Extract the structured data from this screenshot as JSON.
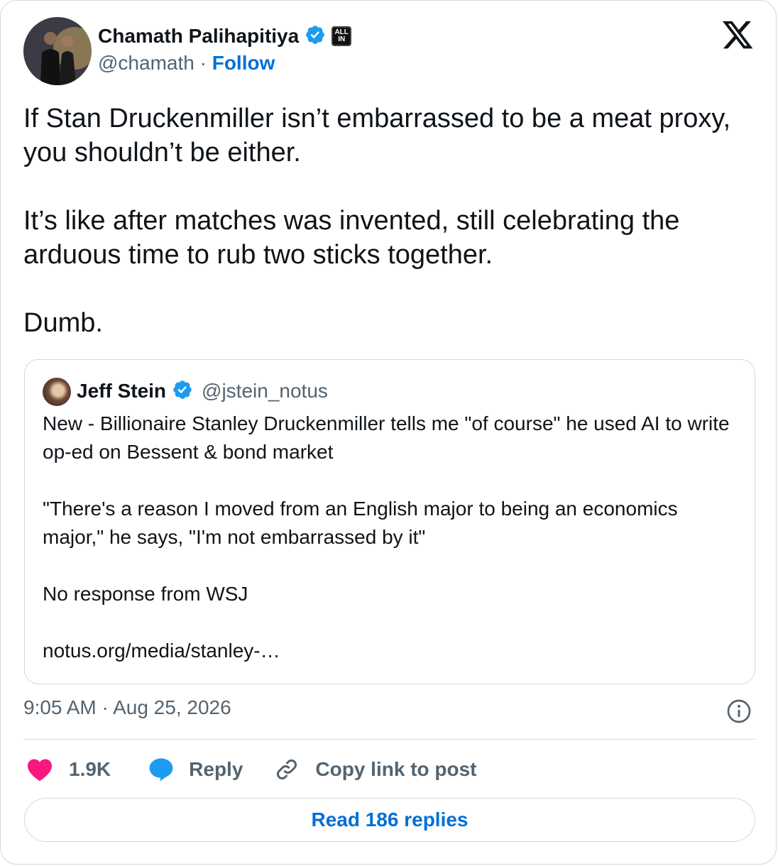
{
  "author": {
    "name": "Chamath Palihapitiya",
    "handle": "@chamath",
    "separator": "·",
    "follow_label": "Follow",
    "badge_text_line1": "ALL",
    "badge_text_line2": "IN"
  },
  "tweet": {
    "paragraphs": [
      "If Stan Druckenmiller isn’t embarrassed to be a meat proxy, you shouldn’t be either.",
      "It’s like after matches was invented, still celebrating the arduous time to rub two sticks together.",
      "Dumb."
    ]
  },
  "quoted_tweet": {
    "name": "Jeff Stein",
    "handle": "@jstein_notus",
    "paragraphs": [
      "New - Billionaire Stanley Druckenmiller tells me \"of course\" he used AI to write op-ed on Bessent & bond market",
      "\"There's a reason I moved from an English major to being an economics major,\" he says, \"I'm not embarrassed by it\"",
      "No response from WSJ",
      "notus.org/media/stanley-…"
    ]
  },
  "timestamp": "9:05 AM · Aug 25, 2026",
  "actions": {
    "like_count": "1.9K",
    "reply_label": "Reply",
    "copy_label": "Copy link to post"
  },
  "read_replies_label": "Read 186 replies",
  "colors": {
    "link_blue": "#006fd6",
    "verified_blue": "#1d9bf0",
    "heart_red": "#f91880",
    "muted_gray": "#536471"
  }
}
